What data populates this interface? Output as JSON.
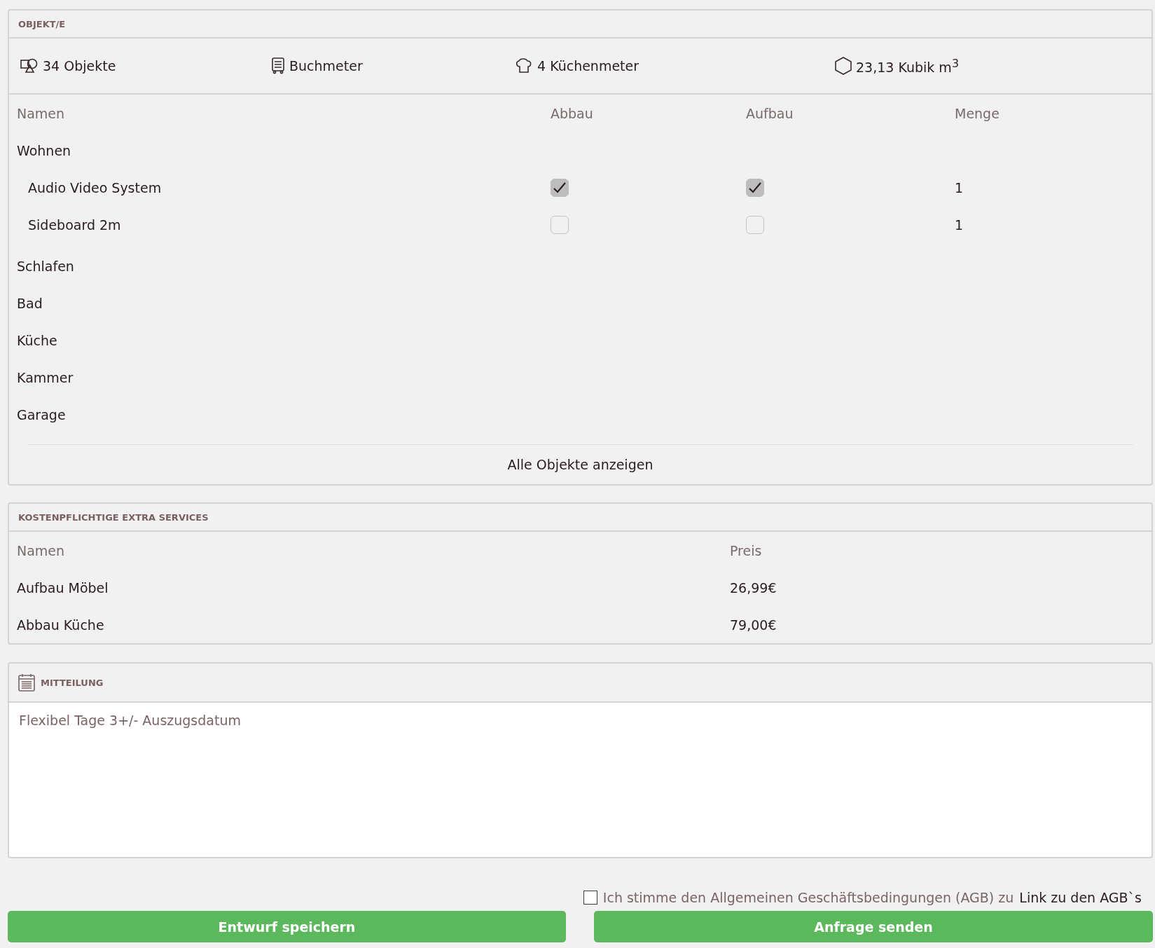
{
  "objects": {
    "title": "OBJEKT/E",
    "summary": [
      {
        "kind": "objects",
        "text": "34 Objekte"
      },
      {
        "kind": "books",
        "text": "Buchmeter"
      },
      {
        "kind": "chef",
        "text": "4 Küchenmeter"
      },
      {
        "kind": "cube",
        "text": "23,13 Kubik m$^{3}$"
      }
    ],
    "columns": [
      "Namen",
      "Abbau",
      "Aufbau",
      "Menge"
    ],
    "groups": [
      {
        "name": "Wohnen",
        "children": [
          {
            "name": "Audio Video System",
            "abbau": true,
            "aufbau": true,
            "menge": "1"
          },
          {
            "name": "Sideboard 2m",
            "abbau": false,
            "aufbau": false,
            "menge": "1"
          }
        ]
      },
      {
        "name": "Schlafen"
      },
      {
        "name": "Bad"
      },
      {
        "name": "Küche"
      },
      {
        "name": "Kammer"
      },
      {
        "name": "Garage"
      }
    ],
    "show_all": "Alle Objekte anzeigen"
  },
  "extras": {
    "title": "KOSTENPFLICHTIGE EXTRA SERVICES",
    "columns": [
      "Namen",
      "Preis"
    ],
    "rows": [
      {
        "name": "Aufbau Möbel",
        "price": "26,99€"
      },
      {
        "name": "Abbau Küche",
        "price": "79,00€"
      }
    ]
  },
  "message": {
    "title": "MITTEILUNG",
    "placeholder": "Flexibel Tage 3+/- Auszugsdatum"
  },
  "terms": {
    "checked": false,
    "text": "Ich stimme den Allgemeinen Geschäftsbedingungen (AGB) zu",
    "link": "Link zu den AGB`s"
  },
  "buttons": [
    "Entwurf speichern",
    "Anfrage senden"
  ]
}
